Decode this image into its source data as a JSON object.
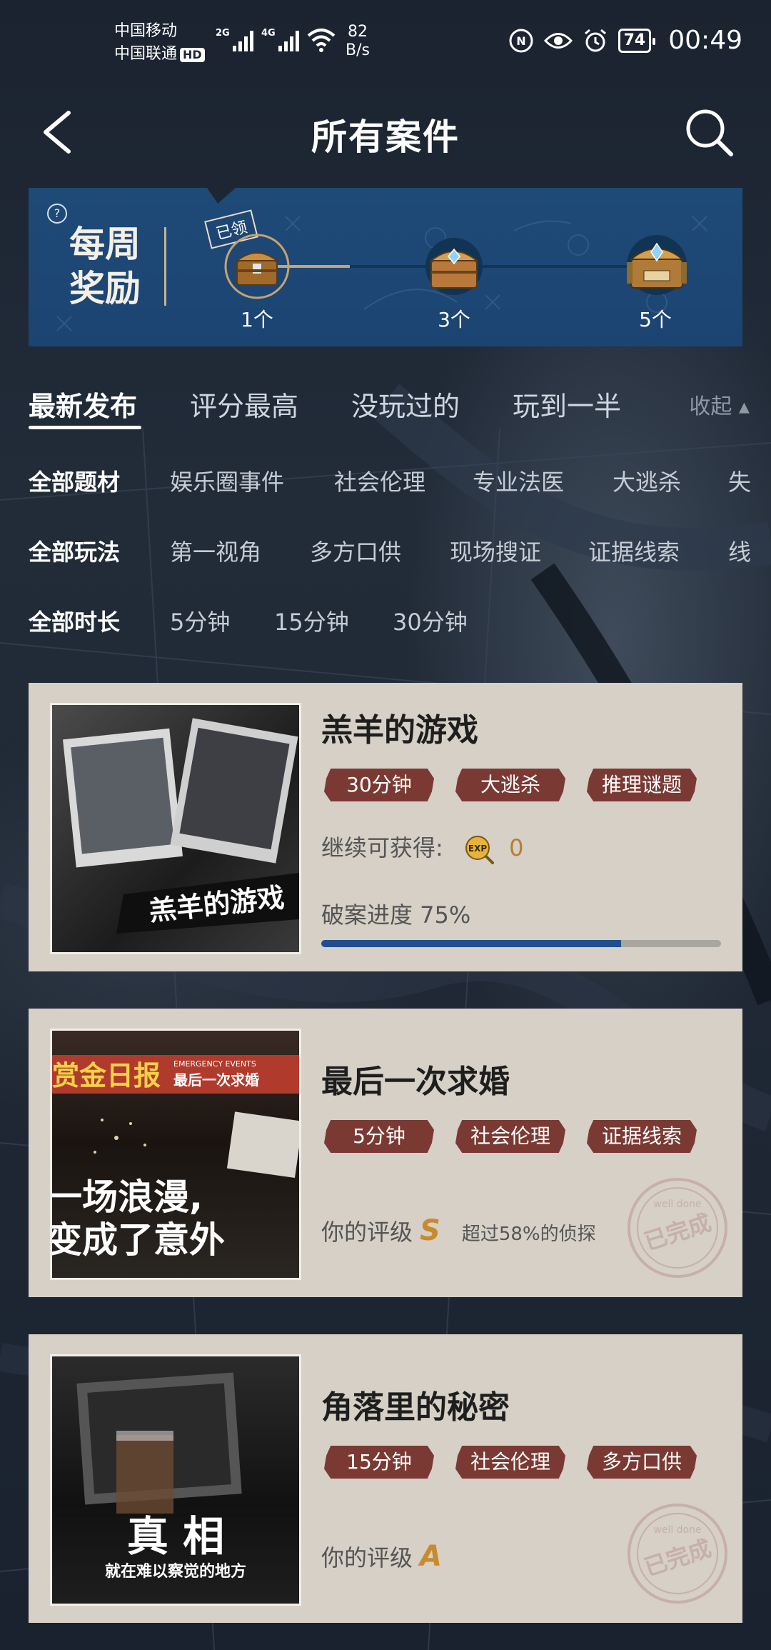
{
  "status_bar": {
    "carrier_1": "中国移动",
    "carrier_2": "中国联通",
    "hd_badge": "HD",
    "net_1": "2G",
    "net_2": "4G",
    "speed_value": "82",
    "speed_unit": "B/s",
    "battery": "74",
    "time": "00:49"
  },
  "header": {
    "title": "所有案件"
  },
  "weekly_reward": {
    "title_line_1": "每周",
    "title_line_2": "奖励",
    "help": "?",
    "claimed_label": "已领",
    "chests": [
      {
        "label": "1个",
        "claimed": true
      },
      {
        "label": "3个",
        "claimed": false
      },
      {
        "label": "5个",
        "claimed": false
      }
    ]
  },
  "sort_tabs": {
    "items": [
      "最新发布",
      "评分最高",
      "没玩过的",
      "玩到一半"
    ],
    "active_index": 0,
    "collapse_label": "收起 ▴"
  },
  "filters": {
    "theme": {
      "lead": "全部题材",
      "options": [
        "娱乐圈事件",
        "社会伦理",
        "专业法医",
        "大逃杀",
        "失"
      ]
    },
    "mode": {
      "lead": "全部玩法",
      "options": [
        "第一视角",
        "多方口供",
        "现场搜证",
        "证据线索",
        "线"
      ]
    },
    "duration": {
      "lead": "全部时长",
      "options": [
        "5分钟",
        "15分钟",
        "30分钟"
      ]
    }
  },
  "cases": [
    {
      "title": "羔羊的游戏",
      "tags": [
        "30分钟",
        "大逃杀",
        "推理谜题"
      ],
      "reward_label": "继续可获得:",
      "exp_icon": "EXP",
      "exp_value": "0",
      "progress_label": "破案进度 75%",
      "progress": 0.75,
      "cover_text": "羔羊的游戏"
    },
    {
      "title": "最后一次求婚",
      "tags": [
        "5分钟",
        "社会伦理",
        "证据线索"
      ],
      "rating_label": "你的评级",
      "grade": "S",
      "beat_text": "超过58%的侦探",
      "stamp_main": "已完成",
      "stamp_sub": "well done",
      "cover_banner": "赏金日报",
      "cover_sub_label": "EMERGENCY EVENTS",
      "cover_episode": "最后一次求婚",
      "cover_line_1": "一场浪漫,",
      "cover_line_2": "变成了意外"
    },
    {
      "title": "角落里的秘密",
      "tags": [
        "15分钟",
        "社会伦理",
        "多方口供"
      ],
      "rating_label": "你的评级",
      "grade": "A",
      "stamp_main": "已完成",
      "stamp_sub": "well done",
      "cover_big": "真 相",
      "cover_small": "就在难以察觉的地方"
    }
  ],
  "colors": {
    "card_bg": "#d6d0c7",
    "tag_bg": "#7a3a33",
    "progress_fill": "#1f4f8e",
    "reward_banner": "#1e4a78",
    "grade": "#c98a2e"
  }
}
